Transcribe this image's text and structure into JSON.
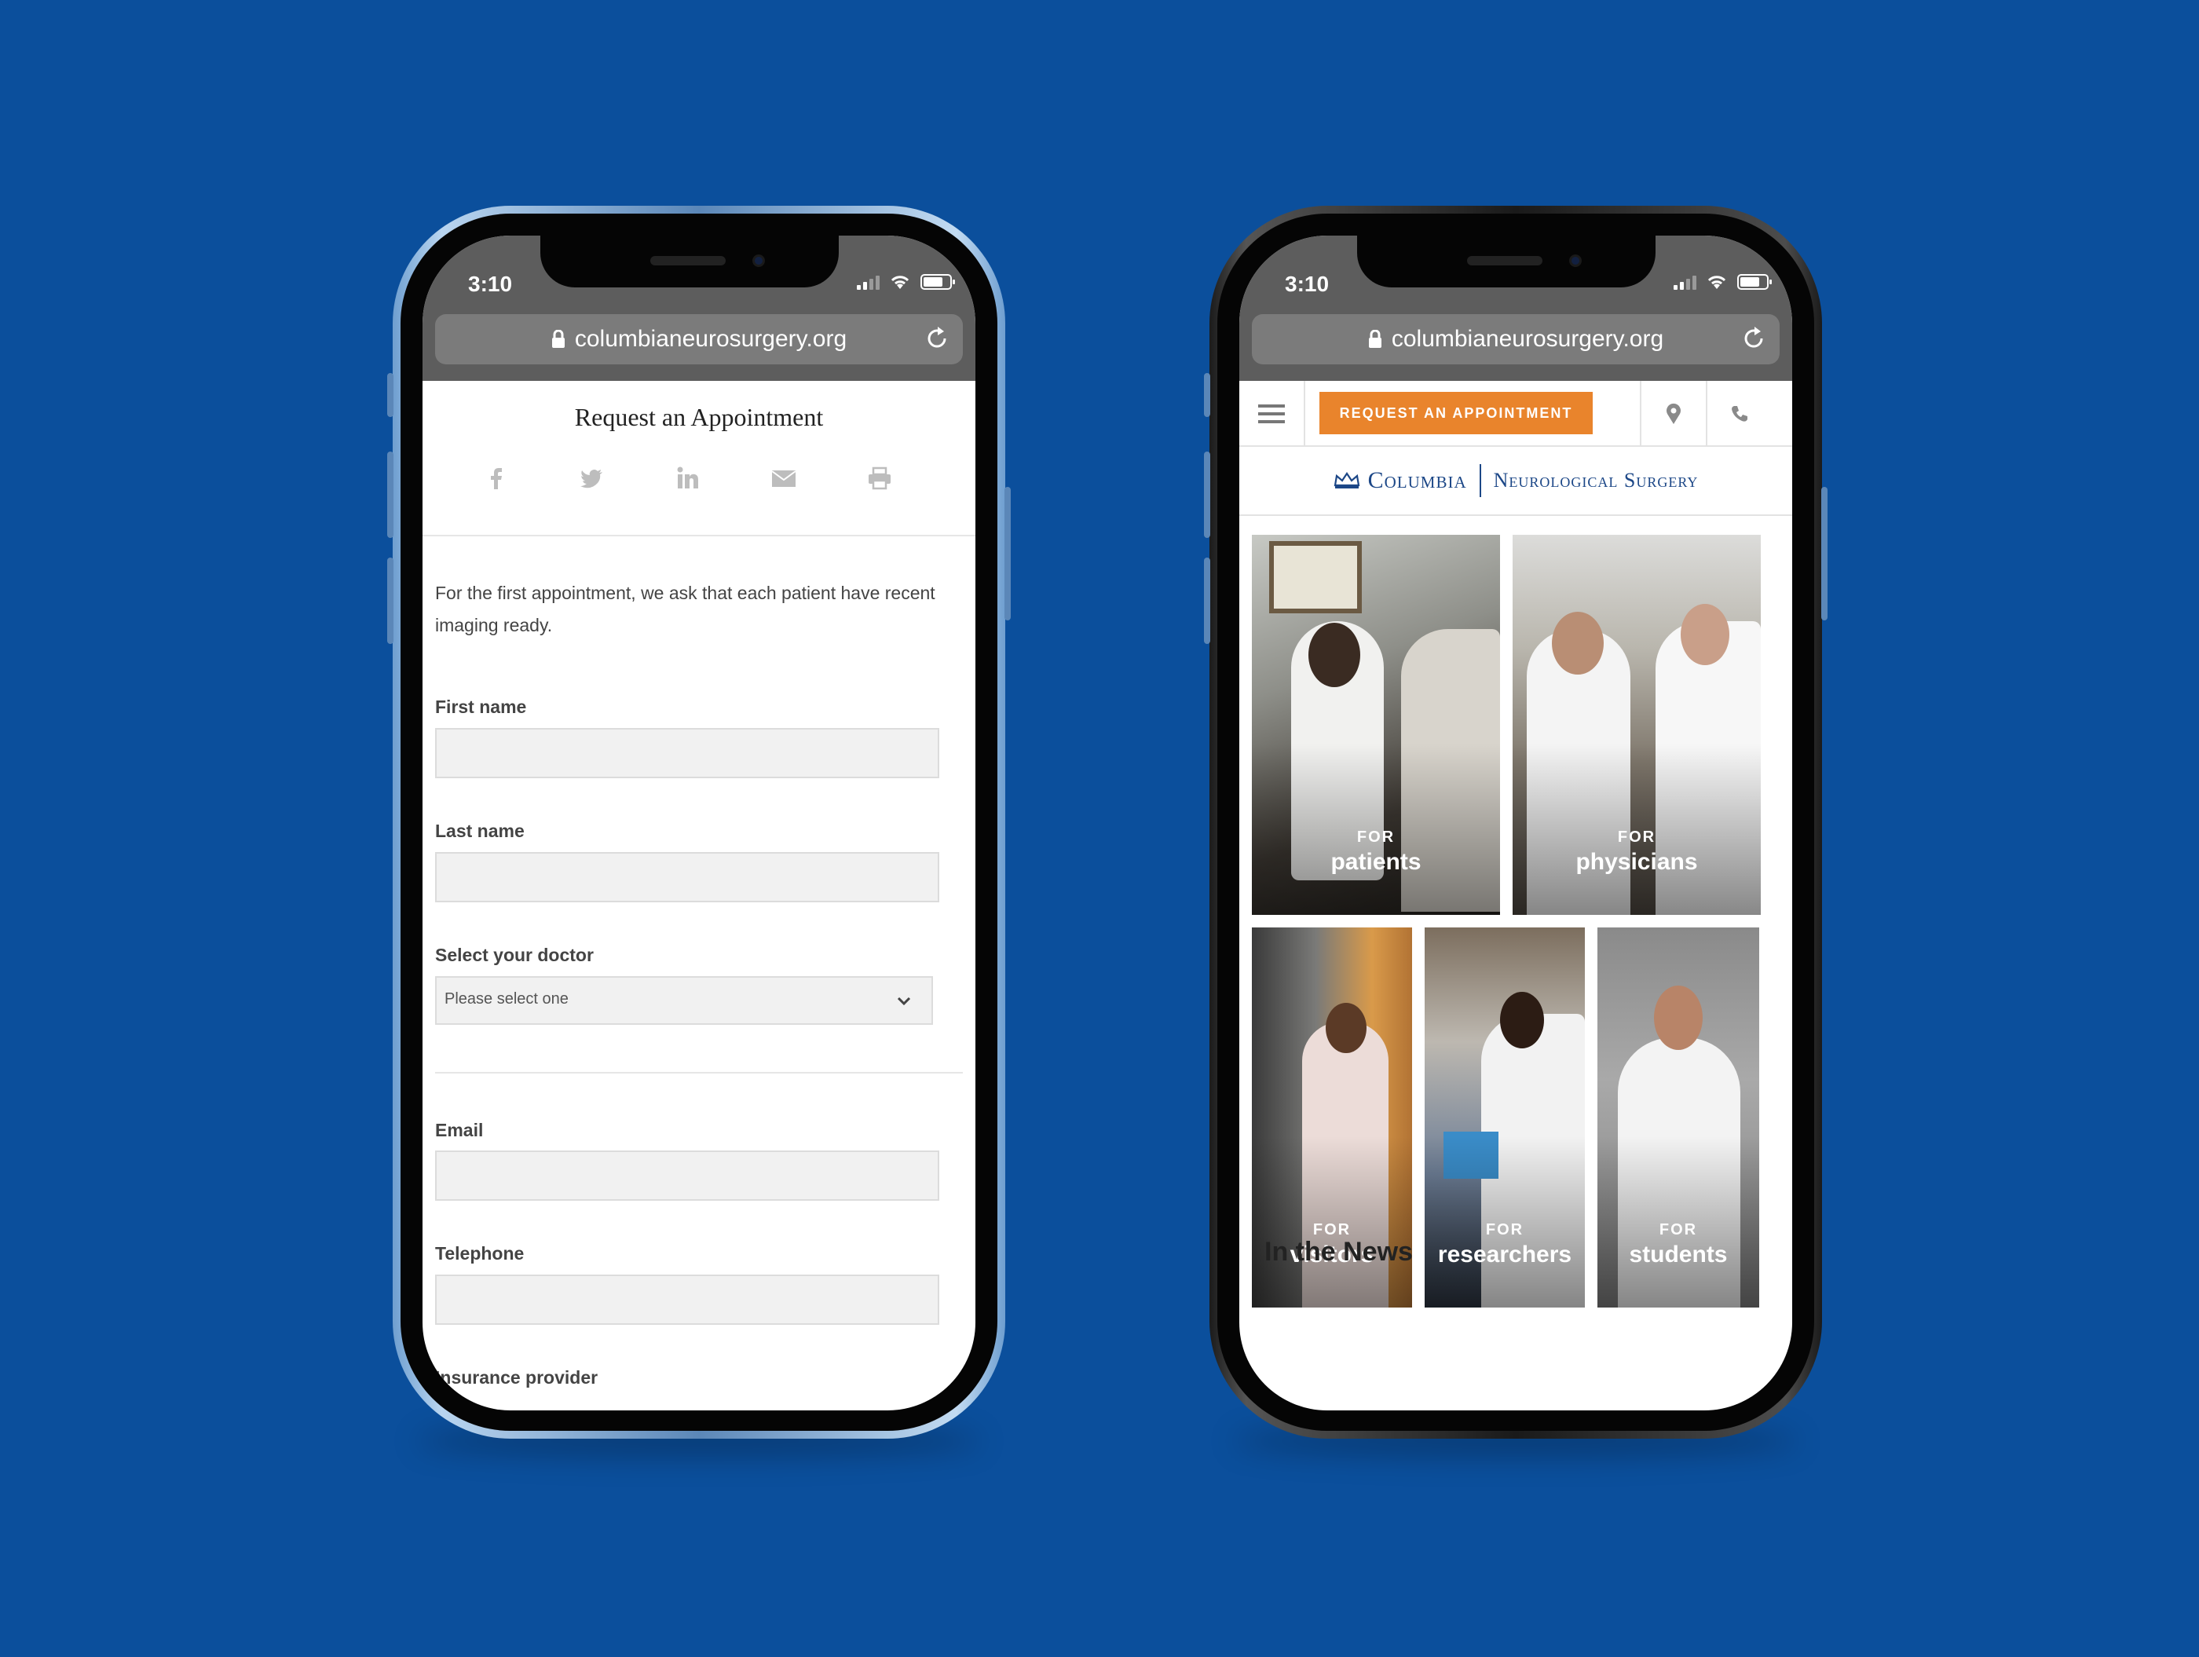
{
  "status": {
    "time": "3:10"
  },
  "browser": {
    "url": "columbianeurosurgery.org"
  },
  "form_page": {
    "title": "Request an Appointment",
    "share_icons": [
      "facebook-icon",
      "twitter-icon",
      "linkedin-icon",
      "email-icon",
      "print-icon"
    ],
    "intro": "For the first appointment, we ask that each patient have recent imaging ready.",
    "fields": {
      "first_name": "First name",
      "last_name": "Last name",
      "doctor": "Select your doctor",
      "doctor_placeholder": "Please select one",
      "email": "Email",
      "telephone": "Telephone",
      "insurance": "Insurance provider"
    }
  },
  "home_page": {
    "cta": "REQUEST AN APPOINTMENT",
    "logo": {
      "columbia": "Columbia",
      "department": "Neurological Surgery"
    },
    "tiles": [
      {
        "for": "FOR",
        "audience": "patients"
      },
      {
        "for": "FOR",
        "audience": "physicians"
      },
      {
        "for": "FOR",
        "audience": "visitors"
      },
      {
        "for": "FOR",
        "audience": "researchers"
      },
      {
        "for": "FOR",
        "audience": "students"
      }
    ],
    "news_heading": "In the News"
  },
  "colors": {
    "background": "#0b4f9c",
    "accent": "#e9842c",
    "brand_blue": "#1c4787"
  }
}
